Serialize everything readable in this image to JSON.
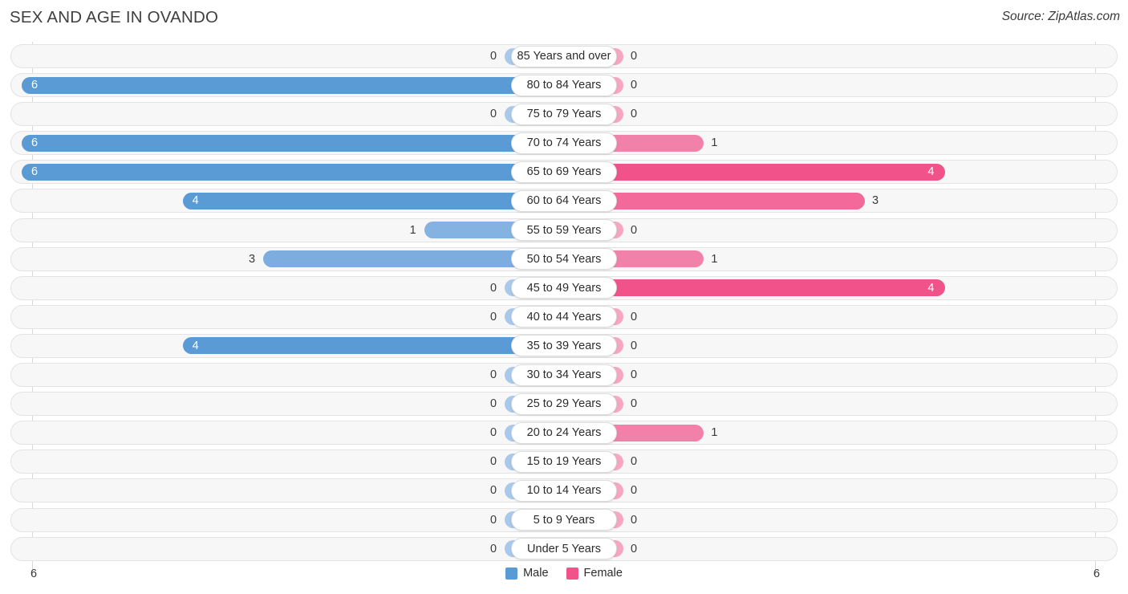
{
  "header": {
    "title": "SEX AND AGE IN OVANDO",
    "source": "Source: ZipAtlas.com"
  },
  "legend": {
    "male_label": "Male",
    "female_label": "Female",
    "male_color": "#5b9bd5",
    "female_color": "#f2528a"
  },
  "axis": {
    "left_max_label": "6",
    "right_max_label": "6",
    "max": 6
  },
  "colors": {
    "male_strong": "#5b9bd5",
    "male_mid": "#84b3e2",
    "male_light": "#a9c9ea",
    "female_strong": "#f2528a",
    "female_mid": "#f281aa",
    "female_light": "#f7a6c2",
    "track_bg": "#f7f7f7",
    "track_border": "#e3e3e3",
    "text": "#3a3a3a"
  },
  "chart_data": {
    "type": "bar",
    "title": "SEX AND AGE IN OVANDO",
    "subtitle": "",
    "xlabel": "",
    "ylabel": "",
    "orientation": "horizontal-diverging",
    "legend_position": "bottom-center",
    "grid": false,
    "xlim": [
      6,
      6
    ],
    "categories": [
      "85 Years and over",
      "80 to 84 Years",
      "75 to 79 Years",
      "70 to 74 Years",
      "65 to 69 Years",
      "60 to 64 Years",
      "55 to 59 Years",
      "50 to 54 Years",
      "45 to 49 Years",
      "40 to 44 Years",
      "35 to 39 Years",
      "30 to 34 Years",
      "25 to 29 Years",
      "20 to 24 Years",
      "15 to 19 Years",
      "10 to 14 Years",
      "5 to 9 Years",
      "Under 5 Years"
    ],
    "series": [
      {
        "name": "Male",
        "values": [
          0,
          6,
          0,
          6,
          6,
          4,
          1,
          3,
          0,
          0,
          4,
          0,
          0,
          0,
          0,
          0,
          0,
          0
        ]
      },
      {
        "name": "Female",
        "values": [
          0,
          0,
          0,
          1,
          4,
          3,
          0,
          1,
          4,
          0,
          0,
          0,
          0,
          1,
          0,
          0,
          0,
          0
        ]
      }
    ]
  },
  "rows": [
    {
      "label": "85 Years and over",
      "male": "0",
      "female": "0"
    },
    {
      "label": "80 to 84 Years",
      "male": "6",
      "female": "0"
    },
    {
      "label": "75 to 79 Years",
      "male": "0",
      "female": "0"
    },
    {
      "label": "70 to 74 Years",
      "male": "6",
      "female": "1"
    },
    {
      "label": "65 to 69 Years",
      "male": "6",
      "female": "4"
    },
    {
      "label": "60 to 64 Years",
      "male": "4",
      "female": "3"
    },
    {
      "label": "55 to 59 Years",
      "male": "1",
      "female": "0"
    },
    {
      "label": "50 to 54 Years",
      "male": "3",
      "female": "1"
    },
    {
      "label": "45 to 49 Years",
      "male": "0",
      "female": "4"
    },
    {
      "label": "40 to 44 Years",
      "male": "0",
      "female": "0"
    },
    {
      "label": "35 to 39 Years",
      "male": "4",
      "female": "0"
    },
    {
      "label": "30 to 34 Years",
      "male": "0",
      "female": "0"
    },
    {
      "label": "25 to 29 Years",
      "male": "0",
      "female": "0"
    },
    {
      "label": "20 to 24 Years",
      "male": "0",
      "female": "1"
    },
    {
      "label": "15 to 19 Years",
      "male": "0",
      "female": "0"
    },
    {
      "label": "10 to 14 Years",
      "male": "0",
      "female": "0"
    },
    {
      "label": "5 to 9 Years",
      "male": "0",
      "female": "0"
    },
    {
      "label": "Under 5 Years",
      "male": "0",
      "female": "0"
    }
  ]
}
